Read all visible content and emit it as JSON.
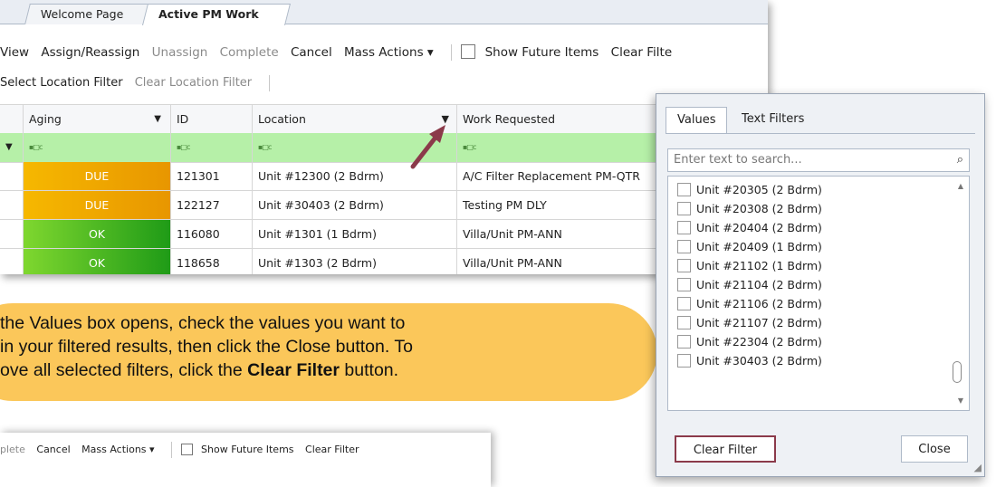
{
  "tabs": [
    {
      "label": "Welcome Page",
      "active": false
    },
    {
      "label": "Active PM Work",
      "active": true
    }
  ],
  "toolbar": {
    "view": "View",
    "assign": "Assign/Reassign",
    "unassign": "Unassign",
    "complete": "Complete",
    "cancel": "Cancel",
    "mass_actions": "Mass Actions ▾",
    "show_future": "Show Future Items",
    "clear_filter": "Clear Filte"
  },
  "toolbar2": {
    "select_location": "Select Location Filter",
    "clear_location": "Clear Location Filter"
  },
  "grid": {
    "columns": [
      "Aging",
      "ID",
      "Location",
      "Work Requested"
    ],
    "filter_row_icon": "▪□c",
    "rows": [
      {
        "aging": "DUE",
        "status": "due",
        "id": "121301",
        "location": "Unit #12300 (2 Bdrm)",
        "work": "A/C Filter Replacement PM-QTR"
      },
      {
        "aging": "DUE",
        "status": "due",
        "id": "122127",
        "location": "Unit #30403 (2 Bdrm)",
        "work": "Testing PM DLY"
      },
      {
        "aging": "OK",
        "status": "ok",
        "id": "116080",
        "location": "Unit #1301 (1 Bdrm)",
        "work": "Villa/Unit PM-ANN"
      },
      {
        "aging": "OK",
        "status": "ok",
        "id": "118658",
        "location": "Unit #1303 (2 Bdrm)",
        "work": "Villa/Unit PM-ANN"
      }
    ]
  },
  "values_panel": {
    "tab_values": "Values",
    "tab_text_filters": "Text Filters",
    "search_placeholder": "Enter text to search...",
    "items": [
      "Unit #20305 (2 Bdrm)",
      "Unit #20308 (2 Bdrm)",
      "Unit #20404 (2 Bdrm)",
      "Unit #20409 (1 Bdrm)",
      "Unit #21102 (1 Bdrm)",
      "Unit #21104 (2 Bdrm)",
      "Unit #21106 (2 Bdrm)",
      "Unit #21107 (2 Bdrm)",
      "Unit #22304 (2 Bdrm)",
      "Unit #30403 (2 Bdrm)"
    ],
    "clear_filter": "Clear Filter",
    "close": "Close"
  },
  "callout": {
    "line1": "the Values box opens, check the values you want to",
    "line2": "in your filtered results, then click the Close button. To",
    "line3_pre": "ove all selected filters, click the ",
    "line3_bold": "Clear Filter",
    "line3_post": " button."
  },
  "toolbar_small": {
    "complete": "plete",
    "cancel": "Cancel",
    "mass_actions": "Mass Actions ▾",
    "show_future": "Show Future Items",
    "clear_filter": "Clear Filter"
  },
  "colors": {
    "callout": "#fbc75a",
    "filter_row": "#b6f0a8",
    "due": "#f0a800",
    "ok": "#3cb521",
    "arrow": "#8b3a4a"
  }
}
